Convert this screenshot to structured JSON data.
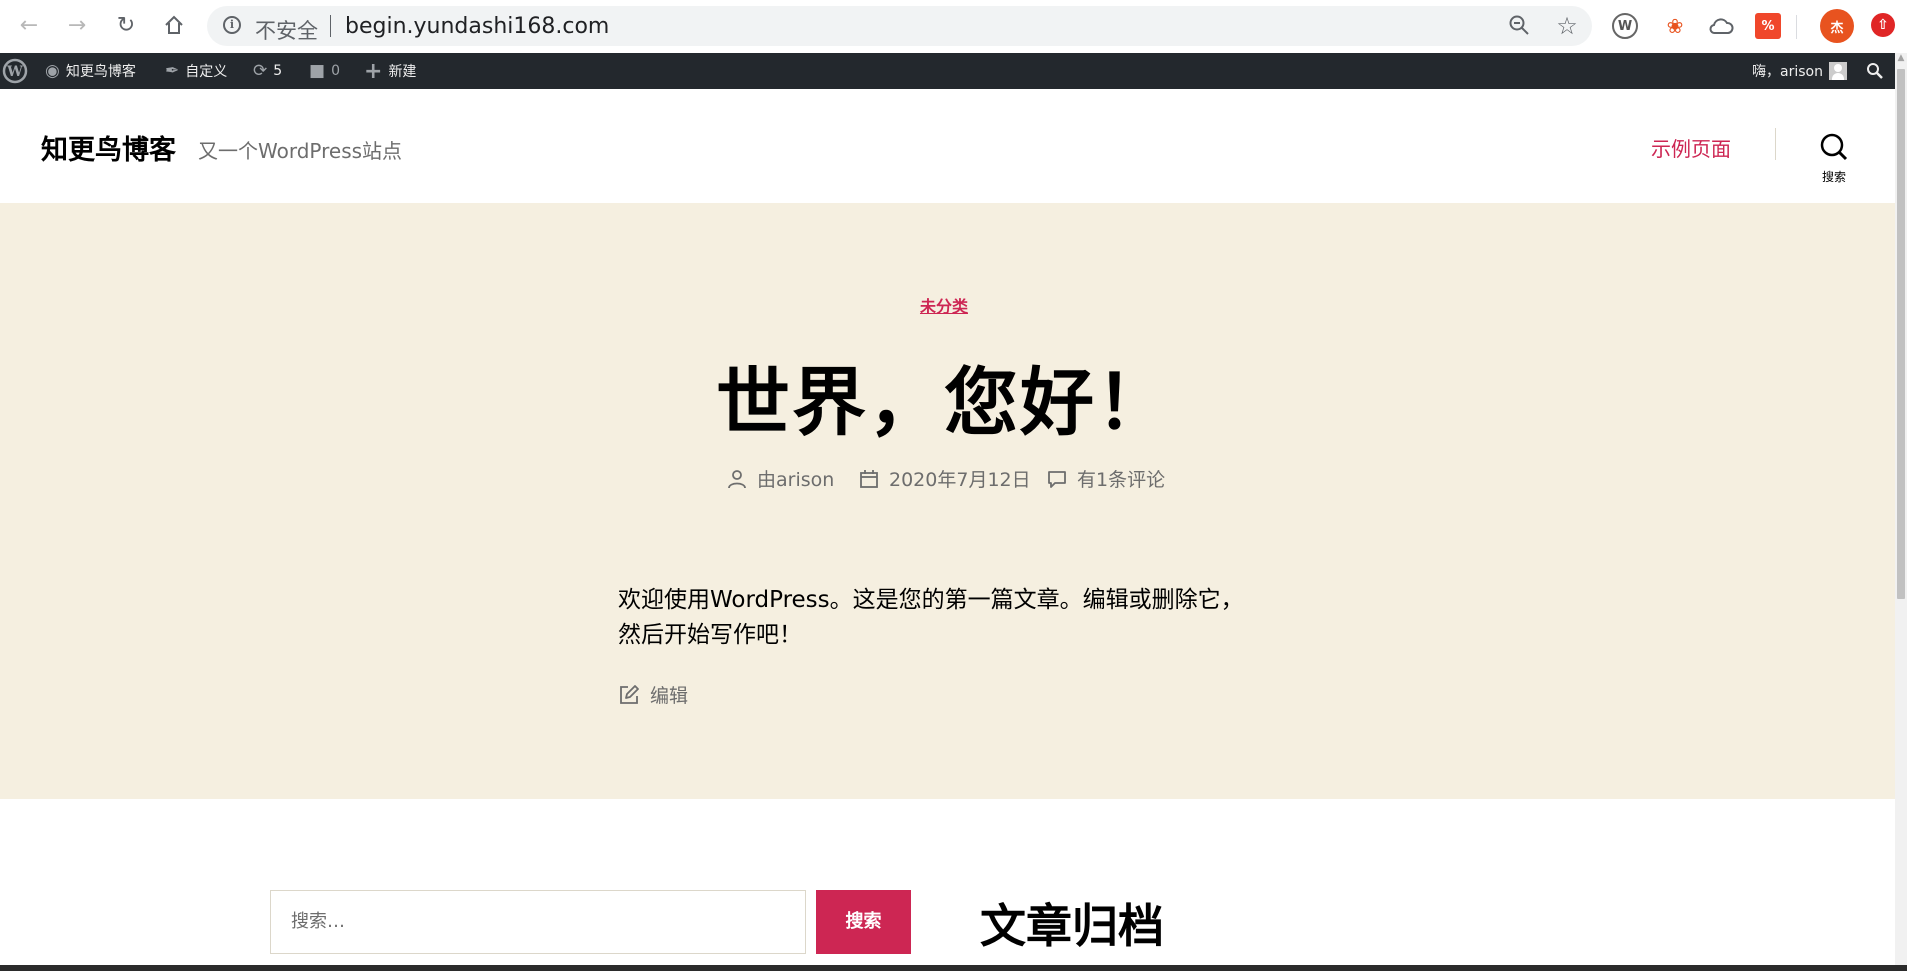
{
  "browser": {
    "security_label": "不安全",
    "url": "begin.yundashi168.com",
    "profile_initial": "杰",
    "colors": {
      "profile": "#e8531f",
      "ext_yellow": "#e8531f",
      "ext_red": "#e02626"
    }
  },
  "admin_bar": {
    "site_name": "知更鸟博客",
    "customize": "自定义",
    "updates_count": "5",
    "comments_count": "0",
    "new": "新建",
    "greeting": "嗨，arison"
  },
  "header": {
    "site_title": "知更鸟博客",
    "site_description": "又一个WordPress站点",
    "nav_items": [
      {
        "label": "示例页面"
      }
    ],
    "search_label": "搜索",
    "accent_color": "#cd2653"
  },
  "post": {
    "category": "未分类",
    "title": "世界，您好！",
    "author": "由arison",
    "date": "2020年7月12日",
    "comments": "有1条评论",
    "content_line1": "欢迎使用WordPress。这是您的第一篇文章。编辑或删除它，",
    "content_line2": "然后开始写作吧！",
    "edit_label": "编辑",
    "hero_background": "#f5efe0"
  },
  "widgets": {
    "search_placeholder": "搜索…",
    "search_button": "搜索",
    "archive_title": "文章归档"
  }
}
